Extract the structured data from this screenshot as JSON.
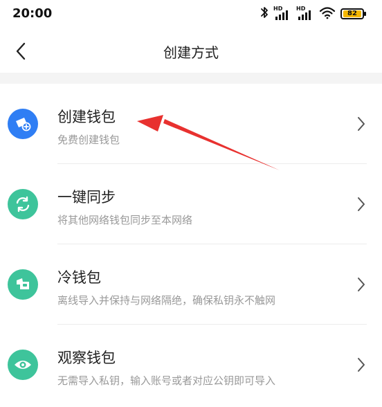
{
  "status_bar": {
    "time": "20:00",
    "hd1": "HD",
    "hd2": "HD",
    "battery": "82",
    "icons": [
      "bluetooth-icon",
      "signal-icon",
      "signal-icon",
      "wifi-icon",
      "battery-icon"
    ],
    "battery_color": "#f5b800"
  },
  "nav": {
    "title": "创建方式",
    "back_icon": "chevron-left-icon"
  },
  "items": [
    {
      "title": "创建钱包",
      "subtitle": "免费创建钱包",
      "icon": "wallet-add-icon",
      "color": "#2f7ef4"
    },
    {
      "title": "一键同步",
      "subtitle": "将其他网络钱包同步至本网络",
      "icon": "sync-icon",
      "color": "#3ec49b"
    },
    {
      "title": "冷钱包",
      "subtitle": "离线导入并保持与网络隔绝，确保私钥永不触网",
      "icon": "cold-wallet-icon",
      "color": "#3ec49b"
    },
    {
      "title": "观察钱包",
      "subtitle": "无需导入私钥，输入账号或者对应公钥即可导入",
      "icon": "eye-icon",
      "color": "#3ec49b"
    }
  ],
  "annotation": {
    "arrow_color": "#e8312f"
  }
}
